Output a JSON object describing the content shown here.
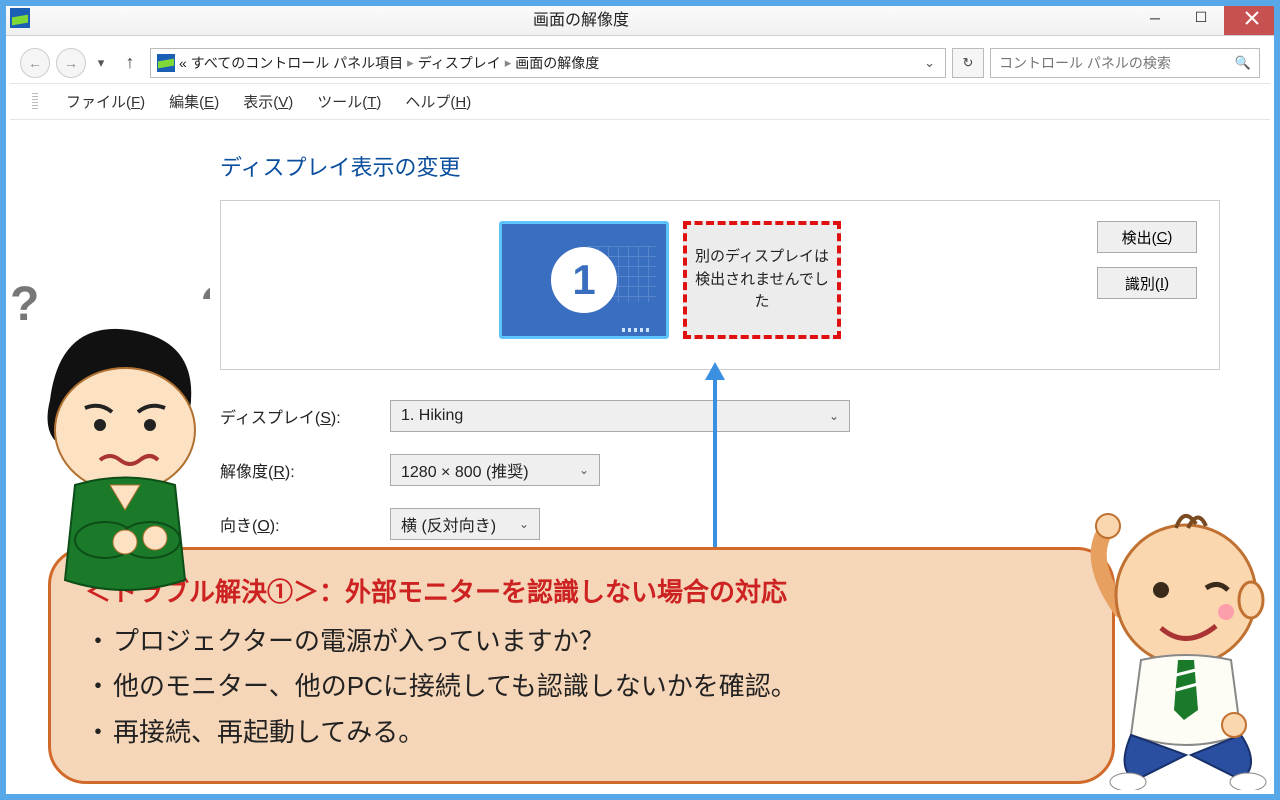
{
  "titlebar": {
    "title": "画面の解像度"
  },
  "nav": {
    "breadcrumb_prefix": "«",
    "crumbs": [
      "すべてのコントロール パネル項目",
      "ディスプレイ",
      "画面の解像度"
    ],
    "search_placeholder": "コントロール パネルの検索"
  },
  "menu": {
    "file": "ファイル(F)",
    "edit": "編集(E)",
    "view": "表示(V)",
    "tools": "ツール(T)",
    "help": "ヘルプ(H)"
  },
  "section": {
    "title": "ディスプレイ表示の変更"
  },
  "monitors": {
    "primary_number": "1",
    "not_detected_msg": "別のディスプレイは検出されませんでした"
  },
  "panel_buttons": {
    "detect": "検出(C)",
    "identify": "識別(I)"
  },
  "form": {
    "display_label": "ディスプレイ(S):",
    "display_value": "1. Hiking",
    "resolution_label": "解像度(R):",
    "resolution_value": "1280 × 800 (推奨)",
    "orientation_label": "向き(O):",
    "orientation_value": "横 (反対向き)"
  },
  "callout": {
    "title": "＜トラブル解決①＞：外部モニターを認識しない場合の対応",
    "items": [
      "プロジェクターの電源が入っていますか？",
      "他のモニター、他のPCに接続しても認識しないかを確認。",
      "再接続、再起動してみる。"
    ]
  }
}
